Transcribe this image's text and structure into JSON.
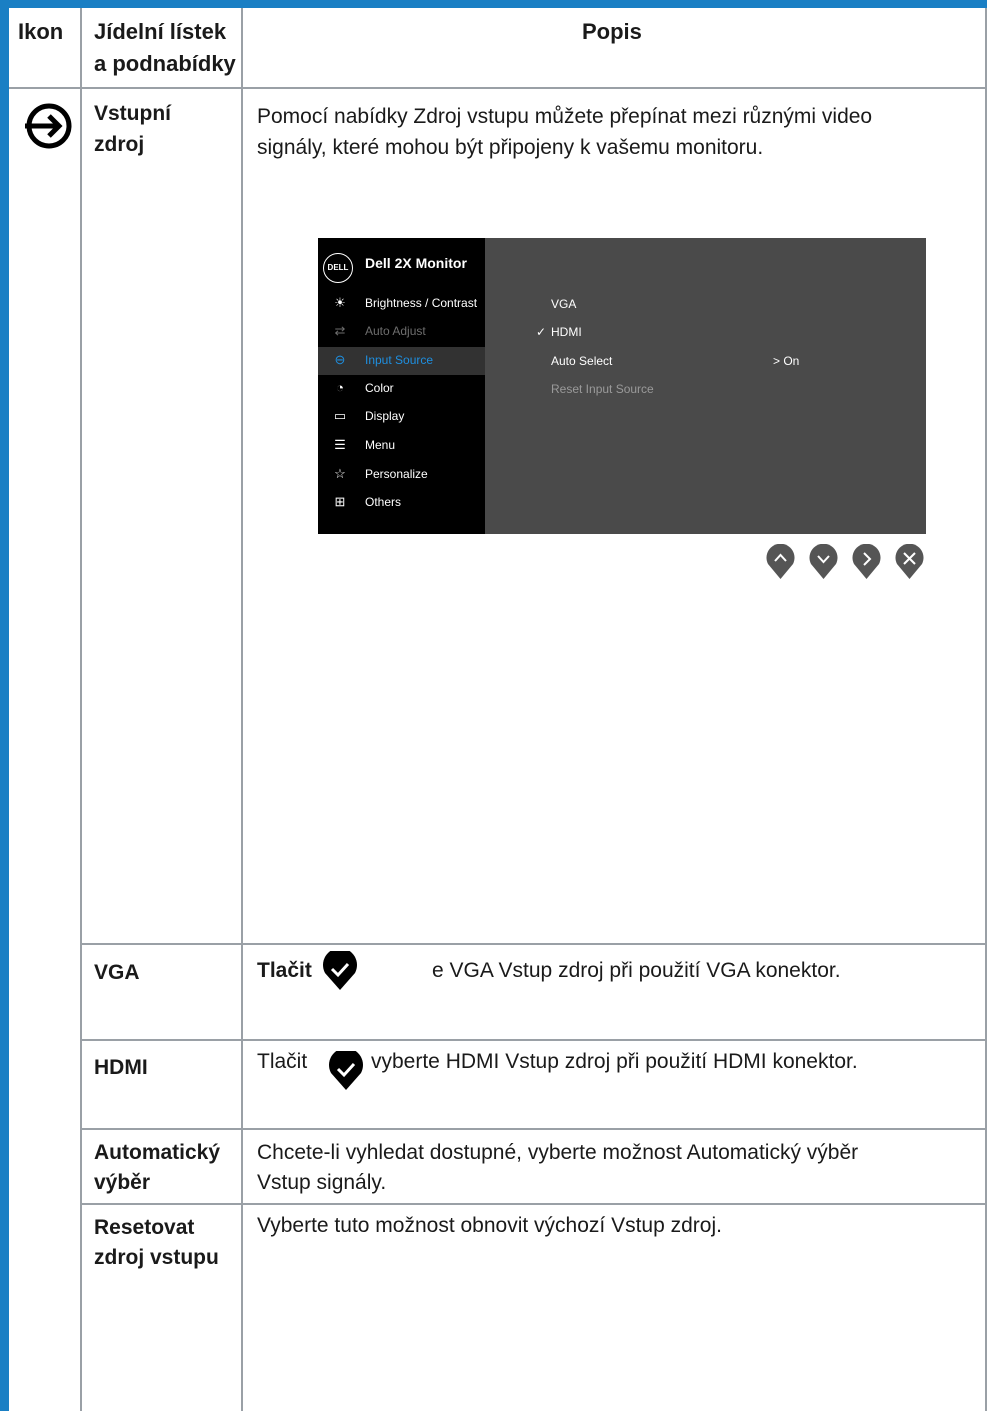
{
  "header": {
    "col1": "Ikon",
    "col2_line1": "Jídelní lístek",
    "col2_line2": "a podnabídky",
    "col3": "Popis"
  },
  "row_input_source": {
    "name_line1": "Vstupní",
    "name_line2": "zdroj",
    "desc_line1": "Pomocí nabídky Zdroj vstupu můžete přepínat mezi různými video",
    "desc_line2": "signály, které mohou být připojeny k vašemu monitoru."
  },
  "osd": {
    "logo": "DELL",
    "title": "Dell 2X Monitor",
    "menu": [
      {
        "label": "Brightness / Contrast",
        "icon": "brightness-icon",
        "state": "normal"
      },
      {
        "label": "Auto Adjust",
        "icon": "auto-adjust-icon",
        "state": "dim"
      },
      {
        "label": "Input Source",
        "icon": "input-source-icon",
        "state": "selected"
      },
      {
        "label": "Color",
        "icon": "color-icon",
        "state": "normal"
      },
      {
        "label": "Display",
        "icon": "display-icon",
        "state": "normal"
      },
      {
        "label": "Menu",
        "icon": "menu-icon",
        "state": "normal"
      },
      {
        "label": "Personalize",
        "icon": "star-icon",
        "state": "normal"
      },
      {
        "label": "Others",
        "icon": "others-icon",
        "state": "normal"
      }
    ],
    "options": {
      "vga": "VGA",
      "hdmi_check": "✓",
      "hdmi": "HDMI",
      "auto_select": "Auto Select",
      "auto_select_value": "> On",
      "reset": "Reset Input Source"
    },
    "colors": {
      "selected": "#1e8fe0",
      "right_panel": "#4a4a4a"
    }
  },
  "rows": {
    "vga_name": "VGA",
    "vga_desc_a": "Tlačit",
    "vga_desc_b": "e VGA Vstup zdroj při použití VGA konektor.",
    "hdmi_name": "HDMI",
    "hdmi_desc_a": "Tlačit",
    "hdmi_desc_b": "vyberte HDMI Vstup zdroj při použití HDMI konektor.",
    "auto_name_line1": "Automatický",
    "auto_name_line2": "výběr",
    "auto_desc_line1": "Chcete-li vyhledat dostupné, vyberte možnost Automatický výběr",
    "auto_desc_line2": "Vstup signály.",
    "reset_name_line1": "Resetovat",
    "reset_name_line2": "zdroj vstupu",
    "reset_desc": "Vyberte tuto možnost obnovit výchozí Vstup zdroj."
  },
  "colors": {
    "accent": "#1a7fc4",
    "gridline": "#9aa0a6"
  }
}
